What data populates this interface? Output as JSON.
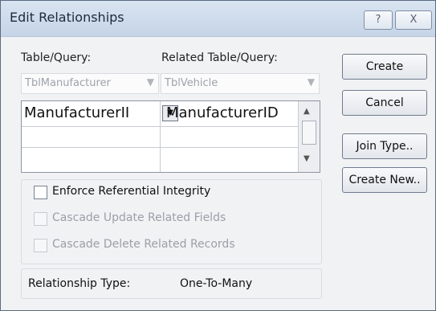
{
  "window": {
    "title": "Edit Relationships",
    "help_label": "?",
    "close_label": "X"
  },
  "table_query": {
    "label": "Table/Query:",
    "value": "TblManufacturer"
  },
  "related_table_query": {
    "label": "Related Table/Query:",
    "value": "TblVehicle"
  },
  "fields_grid": {
    "rows": [
      {
        "left": "ManufacturerII",
        "right": "ManufacturerID"
      },
      {
        "left": "",
        "right": ""
      },
      {
        "left": "",
        "right": ""
      }
    ]
  },
  "buttons": {
    "create": "Create",
    "cancel": "Cancel",
    "join_type": "Join Type..",
    "create_new": "Create New.."
  },
  "options": {
    "enforce_integrity": "Enforce Referential Integrity",
    "cascade_update": "Cascade Update Related Fields",
    "cascade_delete": "Cascade Delete Related Records"
  },
  "relationship": {
    "label": "Relationship Type:",
    "value": "One-To-Many"
  }
}
